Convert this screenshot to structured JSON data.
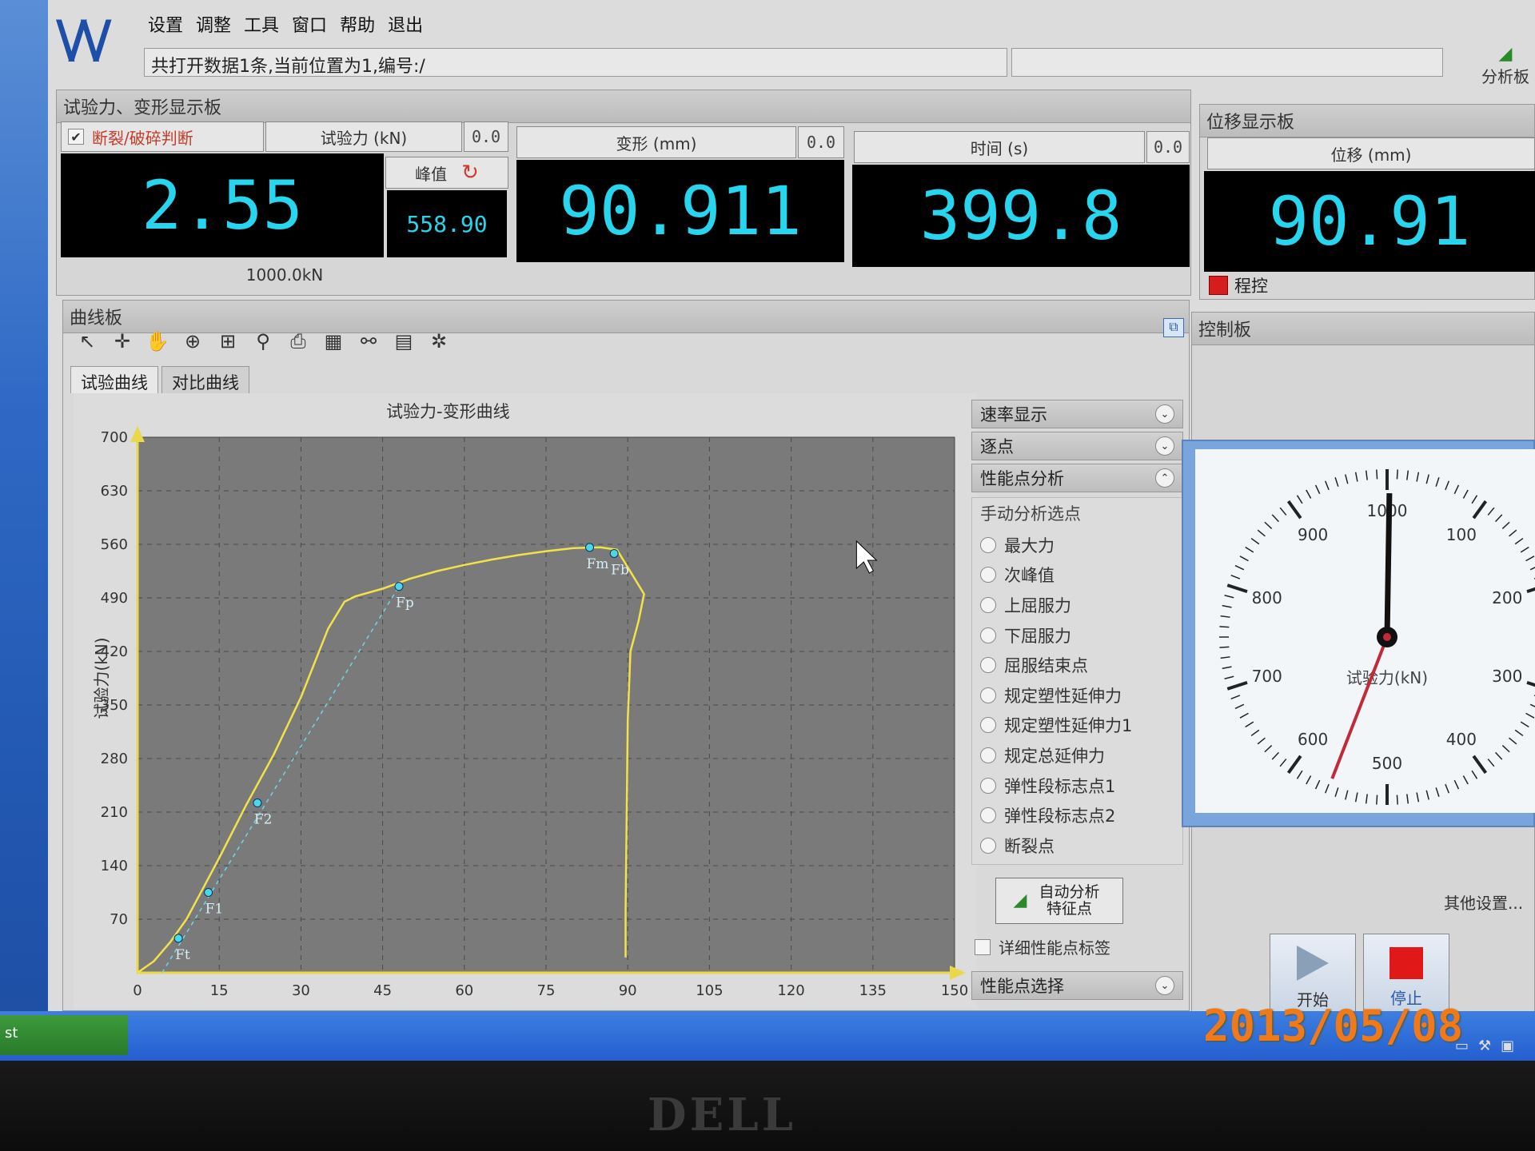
{
  "menu": [
    "设置",
    "调整",
    "工具",
    "窗口",
    "帮助",
    "退出"
  ],
  "status_text": "共打开数据1条,当前位置为1,编号:/",
  "analysis_board": "分析板",
  "force_panel": {
    "title": "试验力、变形显示板",
    "break_check": "断裂/破碎判断",
    "force_header": "试验力 (kN)",
    "force_zero": "0.0",
    "force_value": "2.55",
    "peak_label": "峰值",
    "peak_value": "558.90",
    "capacity": "1000.0kN",
    "deform_header": "变形 (mm)",
    "deform_zero": "0.0",
    "deform_value": "90.911",
    "time_header": "时间 (s)",
    "time_zero": "0.0",
    "time_value": "399.8"
  },
  "disp_panel": {
    "title": "位移显示板",
    "header": "位移 (mm)",
    "value": "90.91",
    "program_label": "程控"
  },
  "curve_panel": {
    "title": "曲线板",
    "tabs": [
      "试验曲线",
      "对比曲线"
    ]
  },
  "side": {
    "rate_display": "速率显示",
    "point_by_point": "逐点",
    "perf_analysis": "性能点分析",
    "manual_title": "手动分析选点",
    "options": [
      "最大力",
      "次峰值",
      "上屈服力",
      "下屈服力",
      "屈服结束点",
      "规定塑性延伸力",
      "规定塑性延伸力1",
      "规定总延伸力",
      "弹性段标志点1",
      "弹性段标志点2",
      "断裂点"
    ],
    "auto_btn": "自动分析特征点",
    "detail_label": "详细性能点标签",
    "perf_select": "性能点选择"
  },
  "control": {
    "title": "控制板",
    "gauge_label": "试验力(kN)",
    "gauge_value": 558.9,
    "gauge_ticks": [
      "0",
      "100",
      "200",
      "300",
      "400",
      "500",
      "600",
      "700",
      "800",
      "900",
      "1000"
    ],
    "other_settings": "其他设置...",
    "start": "开始",
    "stop": "停止"
  },
  "date_stamp": "2013/05/08",
  "taskbar_text": "st",
  "monitor_brand": "DELL",
  "chart_data": {
    "type": "line",
    "title": "试验力-变形曲线",
    "xlabel": "",
    "ylabel": "试验力(kN)",
    "xlim": [
      0,
      150
    ],
    "ylim": [
      0,
      700
    ],
    "xticks": [
      0,
      15,
      30,
      45,
      60,
      75,
      90,
      105,
      120,
      135,
      150
    ],
    "yticks": [
      70,
      140,
      210,
      280,
      350,
      420,
      490,
      560,
      630,
      700
    ],
    "grid": true,
    "series": [
      {
        "x": [
          0,
          3,
          6,
          9,
          12,
          15,
          20,
          25,
          30,
          35,
          38,
          40,
          45,
          50,
          55,
          60,
          65,
          70,
          75,
          80,
          85,
          88,
          90,
          93,
          92,
          90.5,
          90,
          89.8,
          89.6,
          89.6
        ],
        "y": [
          0,
          15,
          40,
          70,
          110,
          150,
          220,
          285,
          360,
          450,
          485,
          492,
          502,
          515,
          525,
          533,
          540,
          546,
          551,
          555,
          556,
          553,
          530,
          495,
          460,
          420,
          330,
          200,
          80,
          20
        ]
      }
    ],
    "points": [
      {
        "label": "Ft",
        "x": 7.5,
        "y": 45
      },
      {
        "label": "F1",
        "x": 13,
        "y": 105
      },
      {
        "label": "F2",
        "x": 22,
        "y": 222
      },
      {
        "label": "Fp",
        "x": 48,
        "y": 505
      },
      {
        "label": "Fm",
        "x": 83,
        "y": 556
      },
      {
        "label": "Fb",
        "x": 87.5,
        "y": 548
      }
    ]
  }
}
